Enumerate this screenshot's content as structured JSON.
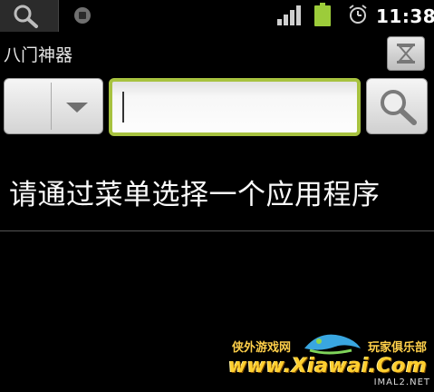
{
  "status_bar": {
    "time": "11:38",
    "icons": [
      "search-icon",
      "record-icon",
      "signal-icon",
      "battery-icon",
      "alarm-icon"
    ],
    "battery_color": "#9ccc3a"
  },
  "app": {
    "title": "八门神器"
  },
  "search": {
    "value": "",
    "accent_color": "#a7c23f"
  },
  "message": "请通过菜单选择一个应用程序",
  "watermark": {
    "left_text": "侠外游戏网",
    "right_text": "玩家俱乐部",
    "url": "www.Xiawai.Com",
    "small_text": "IMAL2.NET"
  }
}
